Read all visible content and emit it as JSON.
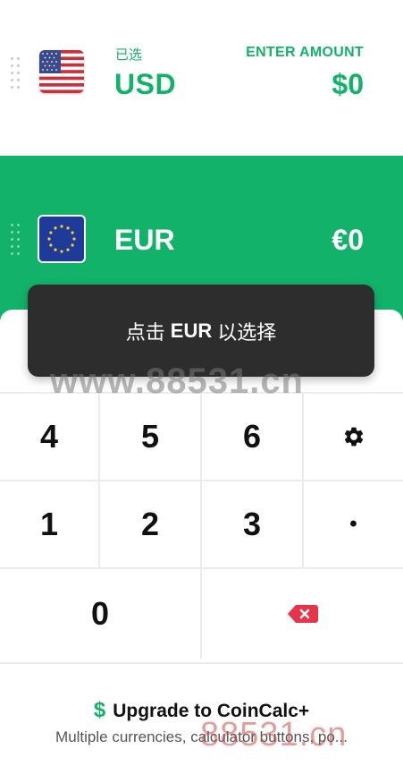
{
  "source_currency": {
    "selected_label": "已选",
    "code": "USD",
    "amount_label": "ENTER AMOUNT",
    "amount": "$0",
    "flag_icon": "us-flag-icon"
  },
  "target_currency": {
    "code": "EUR",
    "amount": "€0",
    "flag_icon": "eu-flag-icon"
  },
  "toast": {
    "prefix": "点击",
    "currency": "EUR",
    "suffix": "以选择"
  },
  "keypad": {
    "row1": [
      "4",
      "5",
      "6"
    ],
    "row2": [
      "1",
      "2",
      "3"
    ],
    "zero": "0",
    "decimal": "•",
    "settings_icon": "gear-icon",
    "backspace_icon": "backspace-icon"
  },
  "upgrade": {
    "icon": "$",
    "title": "Upgrade to CoinCalc+",
    "subtitle": "Multiple currencies, calculator buttons, po..."
  },
  "watermark": {
    "text_top": "www.88531.cn",
    "text_bottom": "88531.cn"
  },
  "colors": {
    "accent": "#12b26a",
    "toast_bg": "#2d2d2d",
    "backspace": "#e8344a"
  }
}
